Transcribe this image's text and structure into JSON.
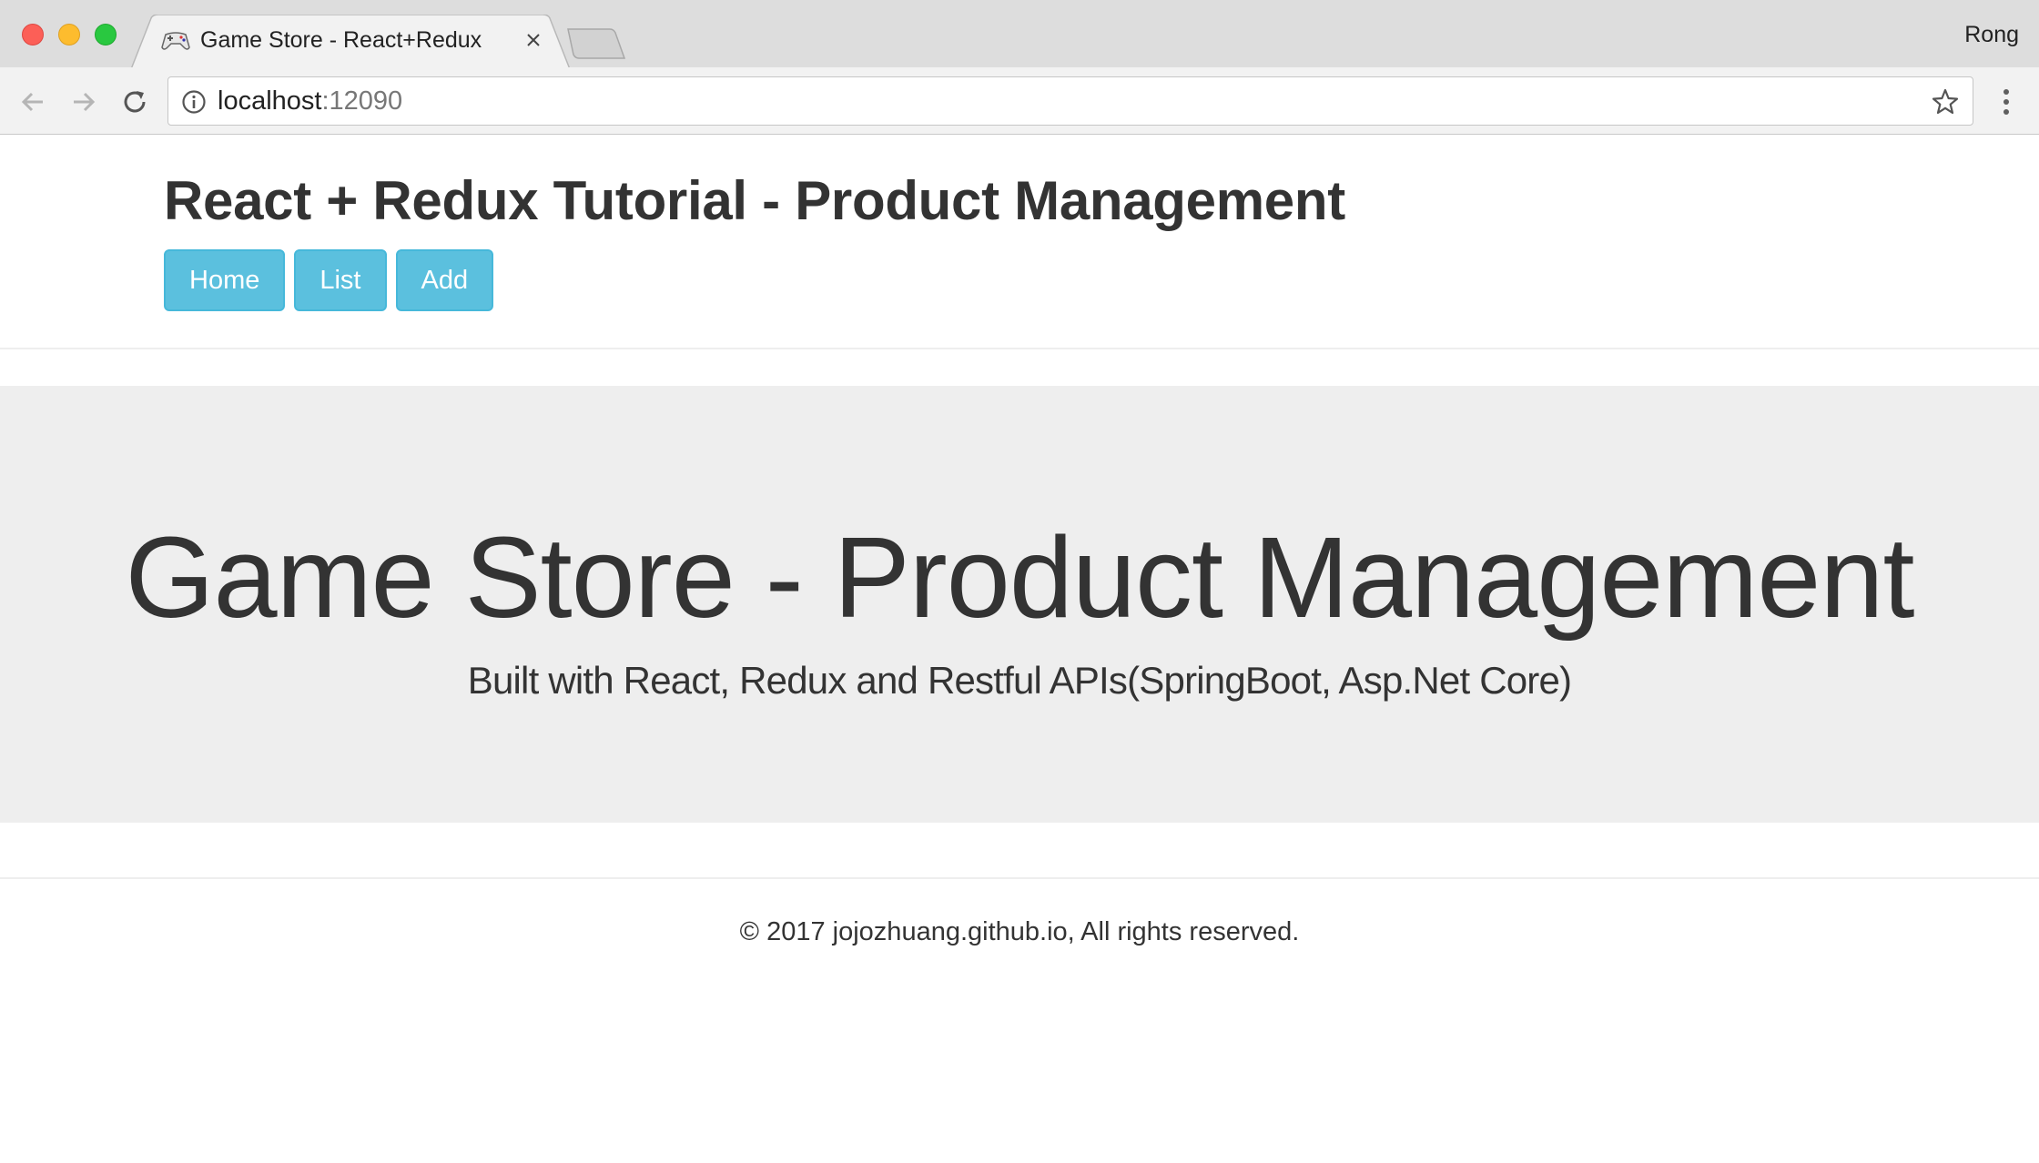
{
  "browser": {
    "tab_title": "Game Store - React+Redux",
    "profile_name": "Rong",
    "url_host": "localhost",
    "url_port": ":12090"
  },
  "header": {
    "title": "React + Redux Tutorial - Product Management",
    "nav": {
      "home": "Home",
      "list": "List",
      "add": "Add"
    }
  },
  "jumbotron": {
    "title": "Game Store - Product Management",
    "subtitle": "Built with React, Redux and Restful APIs(SpringBoot, Asp.Net Core)"
  },
  "footer": {
    "text": "© 2017 jojozhuang.github.io, All rights reserved."
  },
  "colors": {
    "button_info": "#5bc0de",
    "jumbotron_bg": "#eeeeee",
    "text": "#333333"
  },
  "icons": {
    "favicon": "gamepad-icon",
    "back": "arrow-left-icon",
    "forward": "arrow-right-icon",
    "reload": "reload-icon",
    "info": "info-icon",
    "bookmark": "star-icon",
    "menu": "kebab-menu-icon"
  }
}
